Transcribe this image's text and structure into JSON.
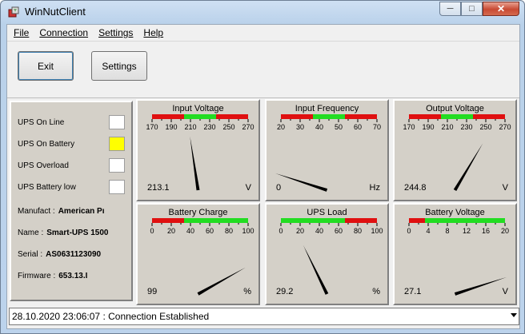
{
  "window": {
    "title": "WinNutClient"
  },
  "menu": [
    "File",
    "Connection",
    "Settings",
    "Help"
  ],
  "toolbar": {
    "exit_label": "Exit",
    "settings_label": "Settings"
  },
  "status": {
    "indicators": [
      {
        "label": "UPS On Line",
        "active": false
      },
      {
        "label": "UPS On Battery",
        "active": true
      },
      {
        "label": "UPS Overload",
        "active": false
      },
      {
        "label": "UPS Battery low",
        "active": false
      }
    ],
    "info": [
      {
        "label": "Manufact :",
        "value": "American Pı"
      },
      {
        "label": "Name :",
        "value": "Smart-UPS 1500"
      },
      {
        "label": "Serial :",
        "value": "AS0631123090"
      },
      {
        "label": "Firmware :",
        "value": "653.13.I"
      }
    ],
    "active_color": "#ffff00"
  },
  "gauges": [
    {
      "title": "Input Voltage",
      "ticks": [
        "170",
        "190",
        "210",
        "230",
        "250",
        "270"
      ],
      "min": 170,
      "max": 270,
      "value": 213.1,
      "display": "213.1",
      "unit": "V",
      "bands": [
        "red",
        "red",
        "green",
        "green",
        "red",
        "red"
      ]
    },
    {
      "title": "Input Frequency",
      "ticks": [
        "20",
        "30",
        "40",
        "50",
        "60",
        "70"
      ],
      "min": 20,
      "max": 70,
      "value": 0,
      "display": "0",
      "unit": "Hz",
      "bands": [
        "red",
        "red",
        "green",
        "green",
        "red",
        "red"
      ]
    },
    {
      "title": "Output Voltage",
      "ticks": [
        "170",
        "190",
        "210",
        "230",
        "250",
        "270"
      ],
      "min": 170,
      "max": 270,
      "value": 244.8,
      "display": "244.8",
      "unit": "V",
      "bands": [
        "red",
        "red",
        "green",
        "green",
        "red",
        "red"
      ]
    },
    {
      "title": "Battery Charge",
      "ticks": [
        "0",
        "20",
        "40",
        "60",
        "80",
        "100"
      ],
      "min": 0,
      "max": 100,
      "value": 99,
      "display": "99",
      "unit": "%",
      "bands": [
        "red",
        "red",
        "green",
        "green",
        "green",
        "green"
      ]
    },
    {
      "title": "UPS Load",
      "ticks": [
        "0",
        "20",
        "40",
        "60",
        "80",
        "100"
      ],
      "min": 0,
      "max": 100,
      "value": 29.2,
      "display": "29.2",
      "unit": "%",
      "bands": [
        "green",
        "green",
        "green",
        "green",
        "red",
        "red"
      ]
    },
    {
      "title": "Battery Voltage",
      "ticks": [
        "0",
        "4",
        "8",
        "12",
        "16",
        "20"
      ],
      "min": 0,
      "max": 20,
      "value": 27.1,
      "display": "27.1",
      "unit": "V",
      "bands": [
        "red",
        "green",
        "green",
        "green",
        "green",
        "green"
      ]
    }
  ],
  "colors": {
    "red": "#e01010",
    "green": "#22dd22",
    "panel": "#d4d0c8"
  },
  "statusbar": {
    "text": "28.10.2020 23:06:07 : Connection Established"
  }
}
